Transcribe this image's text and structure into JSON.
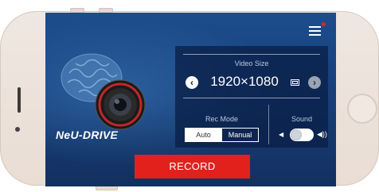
{
  "header": {
    "menu_icon": "menu-icon",
    "notification_dot_color": "#e22222"
  },
  "brand": {
    "logo_text": "NeU-DRIVE"
  },
  "video_size": {
    "label": "Video Size",
    "value": "1920×1080",
    "prev_icon": "chevron-left-icon",
    "next_icon": "chevron-right-icon"
  },
  "rec_mode": {
    "label": "Rec Mode",
    "options": [
      "Auto",
      "Manual"
    ],
    "selected": "Manual"
  },
  "sound": {
    "label": "Sound",
    "enabled": true
  },
  "record_button": {
    "label": "RECORD",
    "color": "#e3211c"
  }
}
